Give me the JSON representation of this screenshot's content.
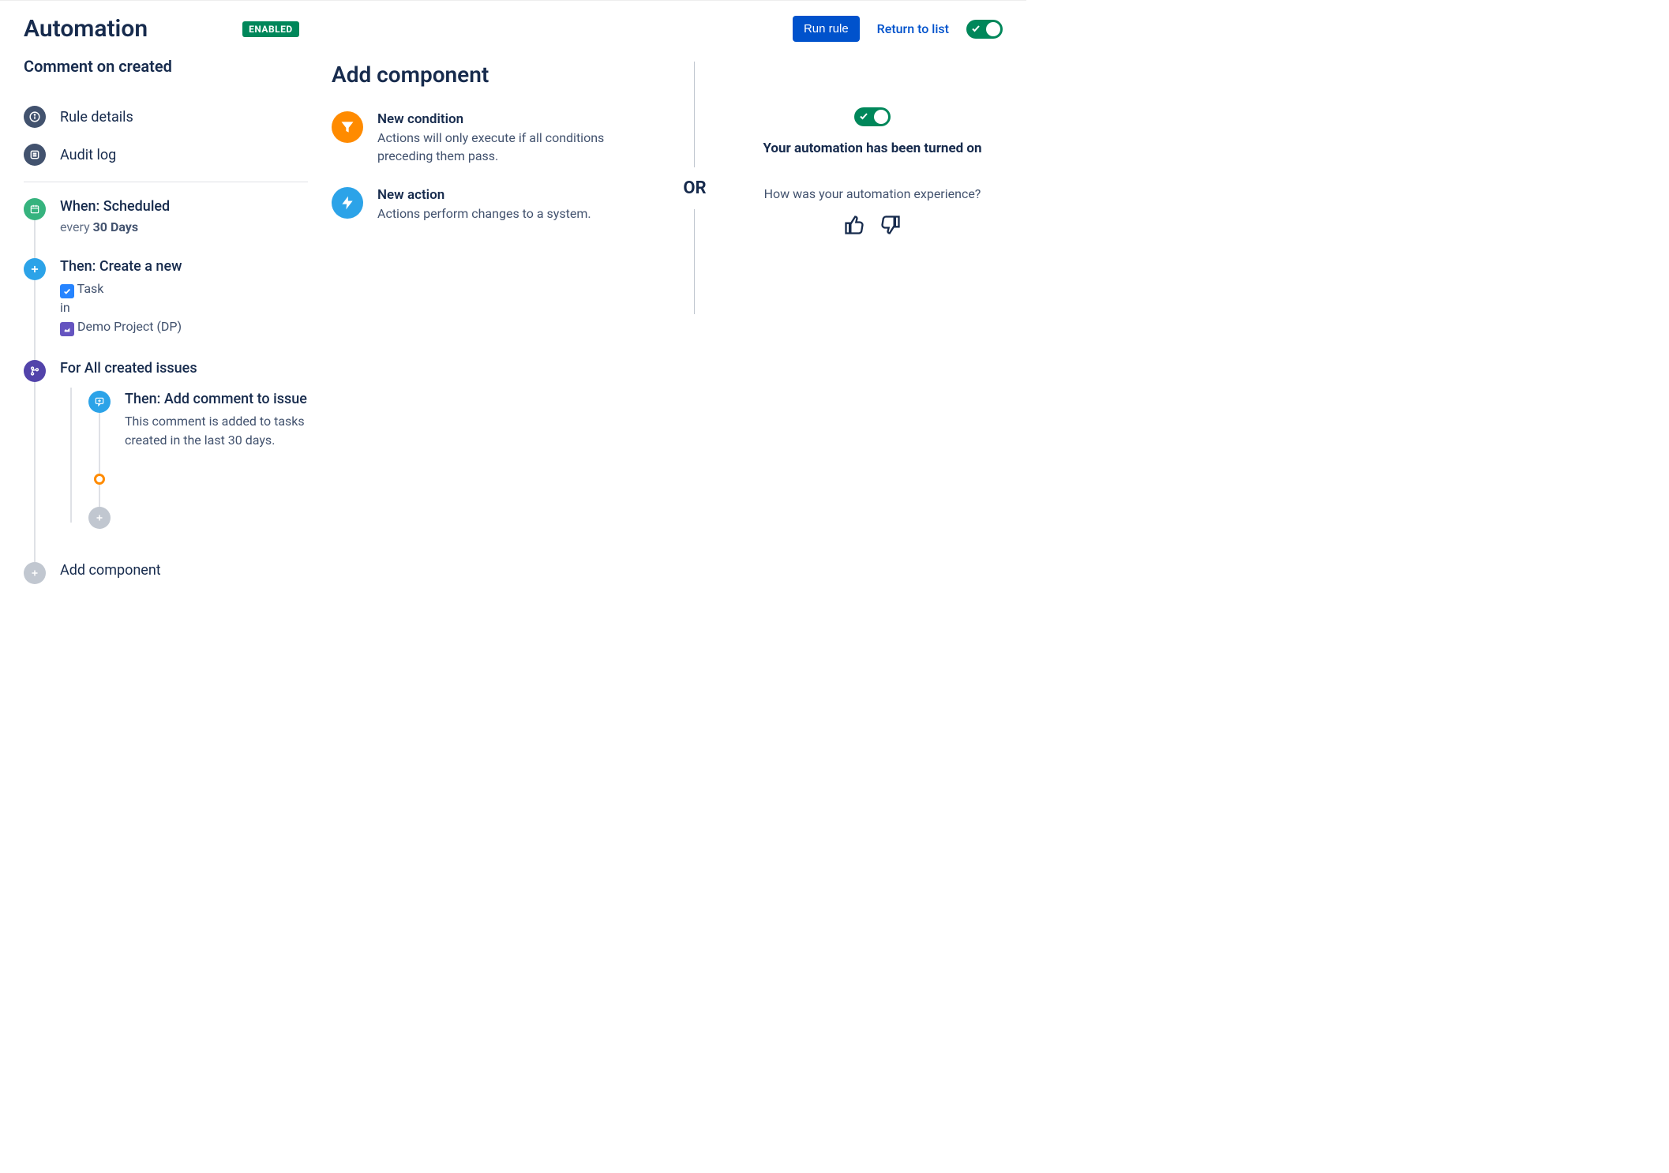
{
  "header": {
    "title": "Automation",
    "badge": "ENABLED",
    "run_button": "Run rule",
    "return_link": "Return to list"
  },
  "rule": {
    "name": "Comment on created",
    "nav": {
      "rule_details": "Rule details",
      "audit_log": "Audit log"
    }
  },
  "steps": {
    "trigger": {
      "title": "When: Scheduled",
      "sub_prefix": "every",
      "sub_bold": "30 Days"
    },
    "action1": {
      "title": "Then: Create a new",
      "type_label": "Task",
      "in_label": "in",
      "project_label": "Demo Project (DP)"
    },
    "branch": {
      "title": "For All created issues"
    },
    "nested_action": {
      "title": "Then: Add comment to issue",
      "desc": "This comment is added to tasks created in the last 30 days."
    },
    "add_component": "Add component"
  },
  "middle": {
    "title": "Add component",
    "condition": {
      "title": "New condition",
      "desc": "Actions will only execute if all conditions preceding them pass."
    },
    "action": {
      "title": "New action",
      "desc": "Actions perform changes to a system."
    }
  },
  "divider": {
    "or": "OR"
  },
  "right": {
    "turned_on": "Your automation has been turned on",
    "feedback_q": "How was your automation experience?"
  }
}
